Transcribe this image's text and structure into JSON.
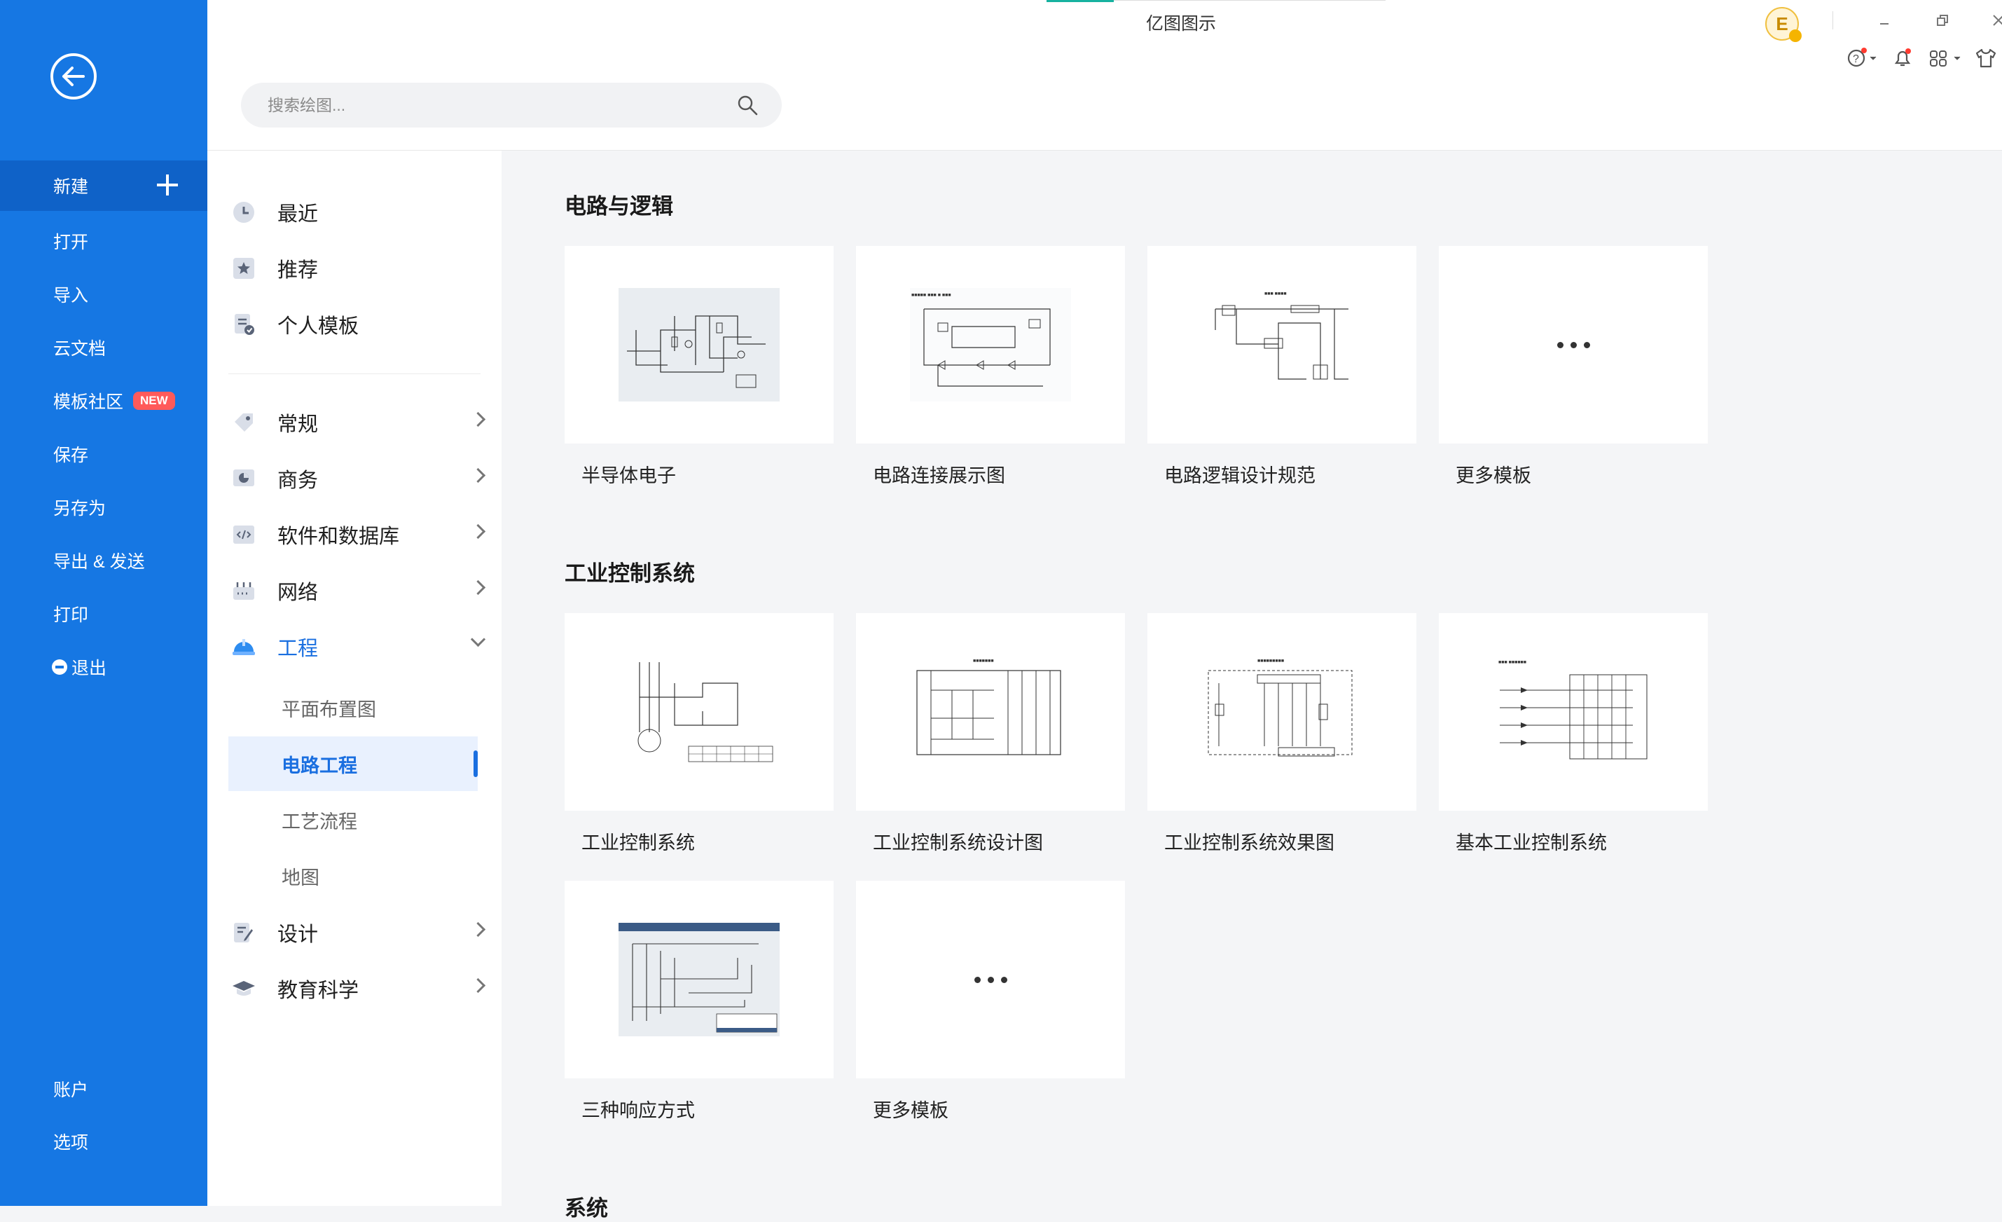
{
  "app": {
    "title": "亿图图示"
  },
  "left_nav": {
    "items": [
      {
        "label": "新建"
      },
      {
        "label": "打开"
      },
      {
        "label": "导入"
      },
      {
        "label": "云文档"
      },
      {
        "label": "模板社区",
        "badge": "NEW"
      },
      {
        "label": "保存"
      },
      {
        "label": "另存为"
      },
      {
        "label": "导出 & 发送"
      },
      {
        "label": "打印"
      },
      {
        "label": "退出"
      }
    ],
    "bottom": [
      {
        "label": "账户"
      },
      {
        "label": "选项"
      }
    ]
  },
  "search": {
    "placeholder": "搜索绘图..."
  },
  "categories": {
    "top": [
      {
        "label": "最近",
        "icon": "clock-icon"
      },
      {
        "label": "推荐",
        "icon": "star-icon"
      },
      {
        "label": "个人模板",
        "icon": "personal-template-icon"
      }
    ],
    "groups": [
      {
        "label": "常规",
        "icon": "tag-icon"
      },
      {
        "label": "商务",
        "icon": "business-chart-icon"
      },
      {
        "label": "软件和数据库",
        "icon": "code-icon"
      },
      {
        "label": "网络",
        "icon": "network-icon"
      },
      {
        "label": "工程",
        "icon": "engineering-helmet-icon",
        "expanded": true
      }
    ],
    "engineering_sub": [
      {
        "label": "平面布置图"
      },
      {
        "label": "电路工程",
        "selected": true
      },
      {
        "label": "工艺流程"
      },
      {
        "label": "地图"
      }
    ],
    "after": [
      {
        "label": "设计",
        "icon": "design-pen-icon"
      },
      {
        "label": "教育科学",
        "icon": "graduation-cap-icon"
      }
    ]
  },
  "sections": [
    {
      "title": "电路与逻辑",
      "templates": [
        {
          "label": "半导体电子"
        },
        {
          "label": "电路连接展示图"
        },
        {
          "label": "电路逻辑设计规范"
        },
        {
          "label": "更多模板",
          "more": true
        }
      ]
    },
    {
      "title": "工业控制系统",
      "templates": [
        {
          "label": "工业控制系统"
        },
        {
          "label": "工业控制系统设计图"
        },
        {
          "label": "工业控制系统效果图"
        },
        {
          "label": "基本工业控制系统"
        },
        {
          "label": "三种响应方式"
        },
        {
          "label": "更多模板",
          "more": true
        }
      ]
    },
    {
      "title": "系统"
    }
  ],
  "user": {
    "avatar_letter": "E"
  },
  "colors": {
    "sidebar": "#1677e3",
    "accent": "#1a6fe0",
    "badge": "#ff5a5a"
  }
}
